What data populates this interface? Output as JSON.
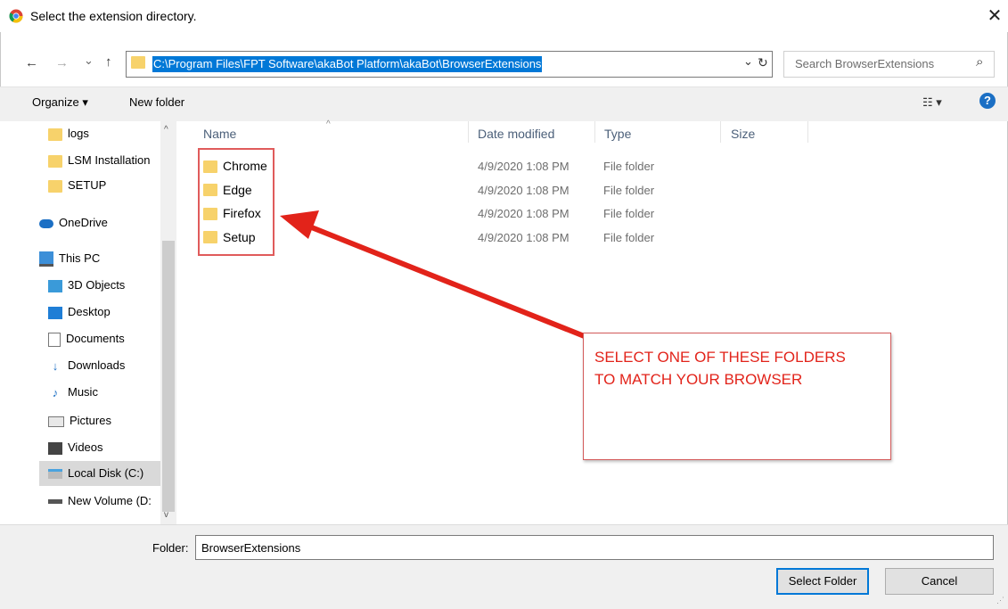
{
  "window": {
    "title": "Select the extension directory.",
    "close_glyph": "✕"
  },
  "address_bar": {
    "path": "C:\\Program Files\\FPT Software\\akaBot Platform\\akaBot\\BrowserExtensions",
    "search_placeholder": "Search BrowserExtensions"
  },
  "nav_buttons": {
    "back": "←",
    "forward": "→",
    "recent": "⌄",
    "up": "↑",
    "dropdown": "⌄",
    "refresh": "↻",
    "search": "⌕"
  },
  "toolbar": {
    "organize": "Organize ▾",
    "new_folder": "New folder",
    "view": "☷ ▾",
    "help": "?"
  },
  "sidebar": {
    "items": [
      {
        "label": "logs",
        "icon": "folder-icon"
      },
      {
        "label": "LSM Installation",
        "icon": "folder-icon"
      },
      {
        "label": "SETUP",
        "icon": "folder-icon"
      },
      {
        "label": "OneDrive",
        "icon": "cloud-icon"
      },
      {
        "label": "This PC",
        "icon": "computer-icon"
      },
      {
        "label": "3D Objects",
        "icon": "cube-icon"
      },
      {
        "label": "Desktop",
        "icon": "desktop-icon"
      },
      {
        "label": "Documents",
        "icon": "document-icon"
      },
      {
        "label": "Downloads",
        "icon": "download-arrow-icon"
      },
      {
        "label": "Music",
        "icon": "music-note-icon"
      },
      {
        "label": "Pictures",
        "icon": "picture-icon"
      },
      {
        "label": "Videos",
        "icon": "film-icon"
      },
      {
        "label": "Local Disk (C:)",
        "icon": "drive-icon"
      },
      {
        "label": "New Volume (D:",
        "icon": "drive-icon"
      }
    ]
  },
  "columns": {
    "name": "Name",
    "date": "Date modified",
    "type": "Type",
    "size": "Size"
  },
  "files": [
    {
      "name": "Chrome",
      "date": "4/9/2020 1:08 PM",
      "type": "File folder"
    },
    {
      "name": "Edge",
      "date": "4/9/2020 1:08 PM",
      "type": "File folder"
    },
    {
      "name": "Firefox",
      "date": "4/9/2020 1:08 PM",
      "type": "File folder"
    },
    {
      "name": "Setup",
      "date": "4/9/2020 1:08 PM",
      "type": "File folder"
    }
  ],
  "annotation": {
    "line1": "SELECT ONE OF THESE FOLDERS",
    "line2": "TO MATCH YOUR BROWSER"
  },
  "footer": {
    "folder_label": "Folder:",
    "folder_value": "BrowserExtensions",
    "select_button": "Select Folder",
    "cancel_button": "Cancel"
  },
  "colors": {
    "accent": "#0078d7",
    "annotation_red": "#e2231a",
    "folder_yellow": "#f7d26b"
  }
}
